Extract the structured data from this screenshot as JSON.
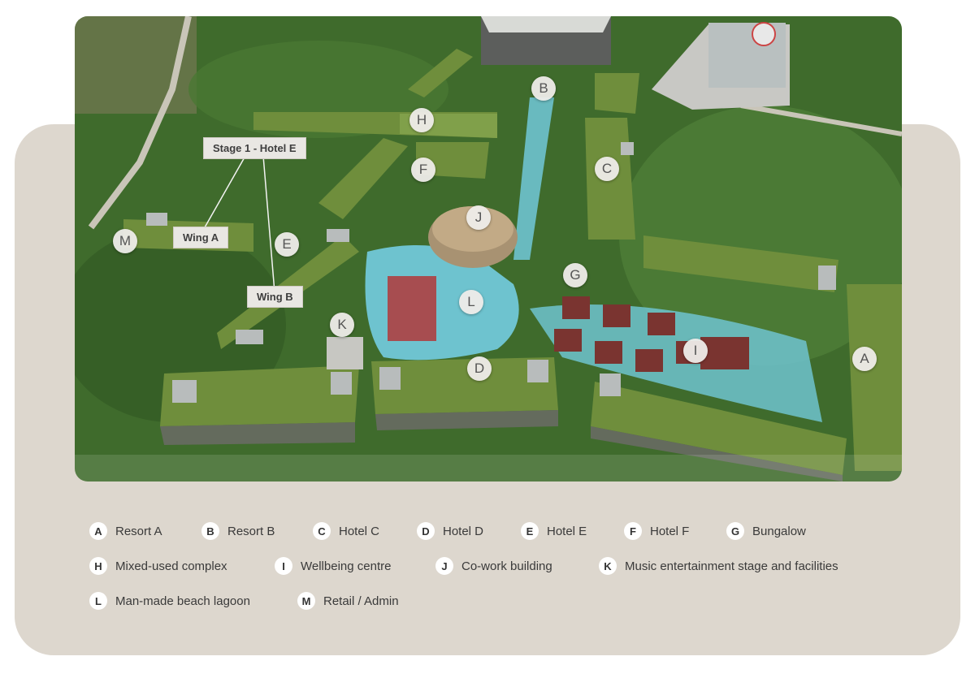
{
  "map": {
    "callouts": {
      "stage": "Stage 1 - Hotel E",
      "wing_a": "Wing A",
      "wing_b": "Wing B"
    },
    "markers": {
      "A": "A",
      "B": "B",
      "C": "C",
      "D": "D",
      "E": "E",
      "F": "F",
      "G": "G",
      "H": "H",
      "I": "I",
      "J": "J",
      "K": "K",
      "L": "L",
      "M": "M"
    }
  },
  "legend": [
    {
      "key": "A",
      "label": "Resort A"
    },
    {
      "key": "B",
      "label": "Resort B"
    },
    {
      "key": "C",
      "label": "Hotel C"
    },
    {
      "key": "D",
      "label": "Hotel D"
    },
    {
      "key": "E",
      "label": "Hotel E"
    },
    {
      "key": "F",
      "label": "Hotel F"
    },
    {
      "key": "G",
      "label": "Bungalow"
    },
    {
      "key": "H",
      "label": "Mixed-used complex"
    },
    {
      "key": "I",
      "label": "Wellbeing centre"
    },
    {
      "key": "J",
      "label": "Co-work building"
    },
    {
      "key": "K",
      "label": "Music entertainment stage and facilities"
    },
    {
      "key": "L",
      "label": "Man-made beach lagoon"
    },
    {
      "key": "M",
      "label": "Retail / Admin"
    }
  ],
  "colors": {
    "panel": "#ddd7ce",
    "forest": "#3f6b2c",
    "roof": "#6f8e3c",
    "water": "#6ec3cf",
    "bungalow": "#7a3430"
  }
}
